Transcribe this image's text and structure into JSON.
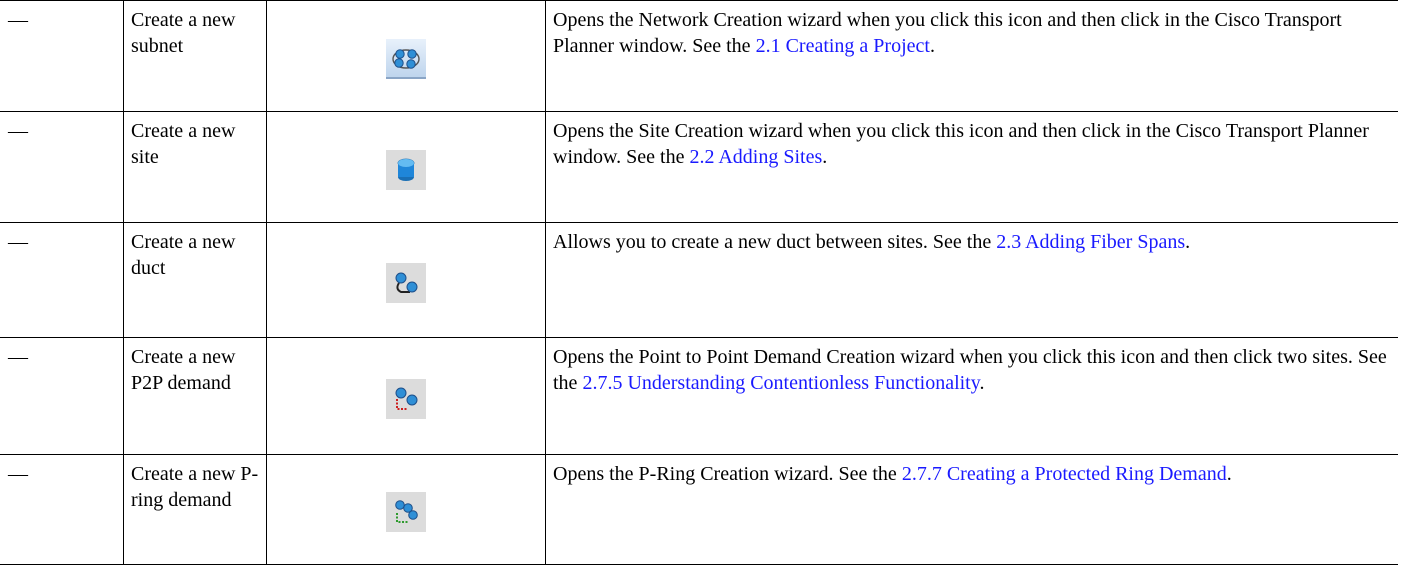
{
  "rows": [
    {
      "dash": "—",
      "task": "Create a new subnet",
      "icon": "create-subnet-icon",
      "desc_pre": "Opens the Network Creation wizard when you click this icon and then click in the Cisco Transport Planner window. See the ",
      "link": "2.1  Creating a Project",
      "desc_post": "."
    },
    {
      "dash": "—",
      "task": "Create a new site",
      "icon": "create-site-icon",
      "desc_pre": "Opens the Site Creation wizard when you click this icon and then click in the Cisco Transport Planner window. See the ",
      "link": "2.2  Adding Sites",
      "desc_post": "."
    },
    {
      "dash": "—",
      "task": "Create a new duct",
      "icon": "create-duct-icon",
      "desc_pre": "Allows you to create a new duct between sites. See the ",
      "link": "2.3  Adding Fiber Spans",
      "desc_post": "."
    },
    {
      "dash": "—",
      "task": "Create a new P2P demand",
      "icon": "create-p2p-demand-icon",
      "desc_pre": "Opens the Point to Point Demand Creation wizard when you click this icon and then click two sites. See the ",
      "link": "2.7.5  Understanding Contentionless Functionality",
      "desc_post": "."
    },
    {
      "dash": "—",
      "task": "Create a new P-ring demand",
      "icon": "create-p-ring-demand-icon",
      "desc_pre": "Opens the P-Ring Creation wizard. See the ",
      "link": "2.7.7  Creating a Protected Ring Demand",
      "desc_post": "."
    }
  ],
  "colors": {
    "link": "#1a1aff",
    "border": "#000000",
    "icon_blue": "#2f8fd6",
    "icon_red": "#cc1f1f",
    "icon_green": "#2e9a2e"
  }
}
